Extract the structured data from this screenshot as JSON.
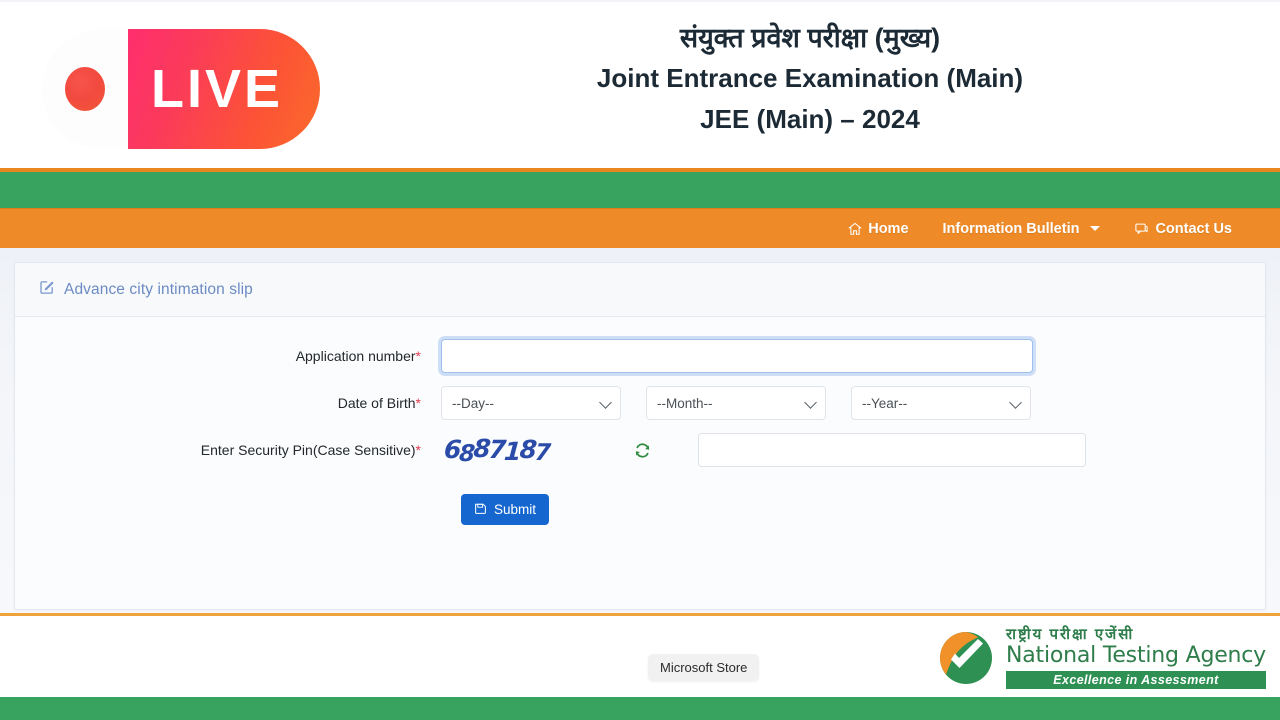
{
  "header": {
    "live_badge_text": "LIVE",
    "title_hindi": "संयुक्त प्रवेश परीक्षा (मुख्य)",
    "title_english": "Joint Entrance Examination (Main)",
    "title_year": "JEE (Main) – 2024"
  },
  "nav": {
    "items": [
      {
        "label": "Home",
        "icon": "home-icon",
        "has_dropdown": false
      },
      {
        "label": "Information Bulletin",
        "icon": "none",
        "has_dropdown": true
      },
      {
        "label": "Contact Us",
        "icon": "contact-icon",
        "has_dropdown": false
      }
    ]
  },
  "card": {
    "title": "Advance city intimation slip",
    "title_icon": "edit-square-icon"
  },
  "form": {
    "application_number": {
      "label": "Application number",
      "required_mark": "*",
      "value": "",
      "placeholder": ""
    },
    "date_of_birth": {
      "label": "Date of Birth",
      "required_mark": "*",
      "day": "--Day--",
      "month": "--Month--",
      "year": "--Year--"
    },
    "security_pin": {
      "label": "Enter Security Pin(Case Sensitive)",
      "required_mark": "*",
      "captcha_text": "6887187",
      "refresh_icon": "refresh-icon",
      "value": "",
      "placeholder": ""
    },
    "submit": {
      "label": "Submit",
      "icon": "save-icon"
    }
  },
  "tooltip": {
    "text": "Microsoft Store"
  },
  "footer": {
    "logo_hindi": "राष्ट्रीय परीक्षा एजेंसी",
    "logo_english": "National Testing Agency",
    "logo_tagline": "Excellence in Assessment"
  },
  "colors": {
    "band_green": "#37a35e",
    "band_orange": "#ee8b28",
    "accent_blue": "#1566cf",
    "required_red": "#e23b4e",
    "card_title_blue": "#6c8bc4",
    "captcha_blue": "#2b4ba8",
    "nta_green": "#2e7d4a"
  }
}
